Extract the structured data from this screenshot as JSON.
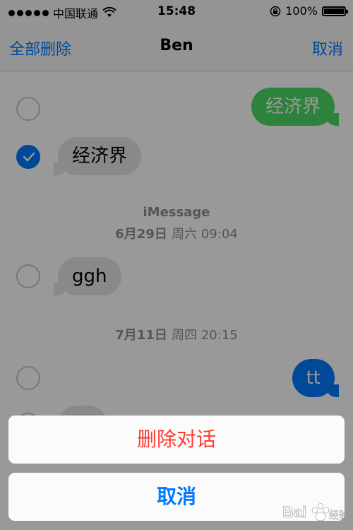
{
  "status_bar": {
    "carrier": "中国联通",
    "time": "15:48",
    "battery": "100%",
    "icons": [
      "signal-dots-icon",
      "wifi-icon",
      "rotation-lock-icon",
      "battery-icon"
    ]
  },
  "nav": {
    "delete_all": "全部删除",
    "title": "Ben",
    "cancel": "取消"
  },
  "messages": [
    {
      "text": "经济界",
      "direction": "outgoing",
      "service": "sms",
      "selected": false
    },
    {
      "text": "经济界",
      "direction": "incoming",
      "selected": true
    }
  ],
  "timestamp1": {
    "service": "iMessage",
    "date": "6月29日",
    "weekday_time": "周六 09:04"
  },
  "message3": {
    "text": "ggh",
    "direction": "incoming",
    "selected": false
  },
  "timestamp2": {
    "date": "7月11日",
    "weekday_time": "周四 20:15"
  },
  "message4": {
    "text": "tt",
    "direction": "outgoing",
    "service": "imessage",
    "selected": false
  },
  "action_sheet": {
    "delete_conversation": "删除对话",
    "cancel": "取消"
  },
  "watermark": "Bai经验",
  "colors": {
    "ios_blue": "#007aff",
    "sms_green": "#4cd964",
    "incoming_gray": "#e5e5ea",
    "destructive_red": "#ff3b30"
  }
}
